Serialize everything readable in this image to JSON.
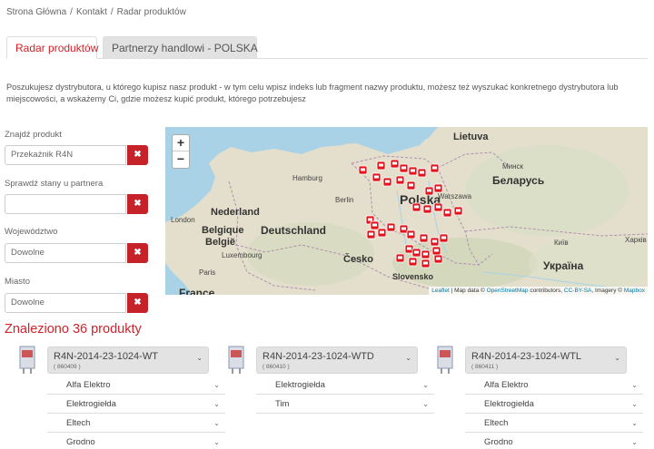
{
  "breadcrumb": {
    "items": [
      "Strona Główna",
      "Kontakt",
      "Radar produktów"
    ],
    "separator": "/"
  },
  "tabs": {
    "active": "Radar produktów",
    "inactive": "Partnerzy handlowi - POLSKA"
  },
  "intro": "Poszukujesz dystrybutora, u którego kupisz nasz produkt - w tym celu wpisz indeks lub fragment nazwy produktu, możesz też wyszukać konkretnego dystrybutora lub miejscowości, a wskażemy Ci, gdzie możesz kupić produkt, którego potrzebujesz",
  "filters": {
    "product": {
      "label": "Znajdź produkt",
      "value": "Przekaźnik R4N"
    },
    "partner": {
      "label": "Sprawdź stany u partnera",
      "value": ""
    },
    "voivodeship": {
      "label": "Województwo",
      "value": "Dowolne"
    },
    "city": {
      "label": "Miasto",
      "value": "Dowolne"
    },
    "clear_symbol": "✖"
  },
  "map": {
    "zoom_in": "+",
    "zoom_out": "−",
    "labels": {
      "lietuva": "Lietuva",
      "polska": "Polska",
      "nederland": "Nederland",
      "deutschland": "Deutschland",
      "belgique": "Belgique",
      "belgie": "België",
      "cesko": "Česko",
      "slovensko": "Slovensko",
      "belarus": "Беларусь",
      "ukraina": "Україна",
      "france": "France",
      "hamburg": "Hamburg",
      "berlin": "Berlin",
      "warszawa": "Warszawa",
      "minsk": "Минск",
      "london": "London",
      "luxembourg": "Luxembourg",
      "paris": "Paris",
      "kyiv": "Київ",
      "kharkiv": "Харків"
    },
    "attribution": {
      "leaflet": "Leaflet",
      "text1": " | Map data © ",
      "osm": "OpenStreetMap",
      "text2": " contributors, ",
      "license": "CC-BY-SA",
      "text3": ", Imagery © ",
      "mapbox": "Mapbox"
    },
    "marker_color": "#e3141c"
  },
  "results": {
    "found": "Znaleziono 36 produkty"
  },
  "products": [
    {
      "name": "R4N-2014-23-1024-WT",
      "code": "( 860409 )",
      "distributors": [
        "Alfa Elektro",
        "Elektrogiełda",
        "Eltech",
        "Grodno"
      ]
    },
    {
      "name": "R4N-2014-23-1024-WTD",
      "code": "( 860410 )",
      "distributors": [
        "Elektrogiełda",
        "Tim"
      ]
    },
    {
      "name": "R4N-2014-23-1024-WTL",
      "code": "( 860411 )",
      "distributors": [
        "Alfa Elektro",
        "Elektrogiełda",
        "Eltech",
        "Grodno"
      ]
    }
  ],
  "colors": {
    "accent": "#d3222a",
    "clear_button": "#c52229"
  }
}
